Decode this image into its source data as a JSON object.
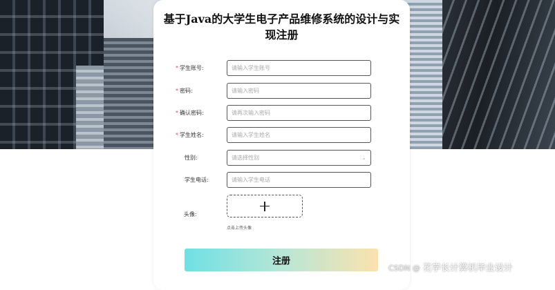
{
  "form": {
    "title": "基于Java的大学生电子产品维修系统的设计与实现注册",
    "fields": [
      {
        "label": "学生账号:",
        "required": true,
        "placeholder": "请输入学生账号"
      },
      {
        "label": "密码:",
        "required": true,
        "placeholder": "请输入密码"
      },
      {
        "label": "确认密码:",
        "required": true,
        "placeholder": "请再次输入密码"
      },
      {
        "label": "学生姓名:",
        "required": true,
        "placeholder": "请输入学生姓名"
      },
      {
        "label": "性别:",
        "required": false,
        "placeholder": "请选择性别"
      },
      {
        "label": "学生电话:",
        "required": false,
        "placeholder": "请输入学生电话"
      }
    ],
    "avatar_label": "头像:",
    "upload_hint": "点击上传头像",
    "register_label": "注册",
    "required_mark": "*"
  },
  "watermark": {
    "csdn": "CSDN @",
    "author": "花学长计算机毕业设计"
  },
  "colors": {
    "required": "#e5484d",
    "button_start": "#6fe0e4",
    "button_end": "#fbe2ad"
  }
}
